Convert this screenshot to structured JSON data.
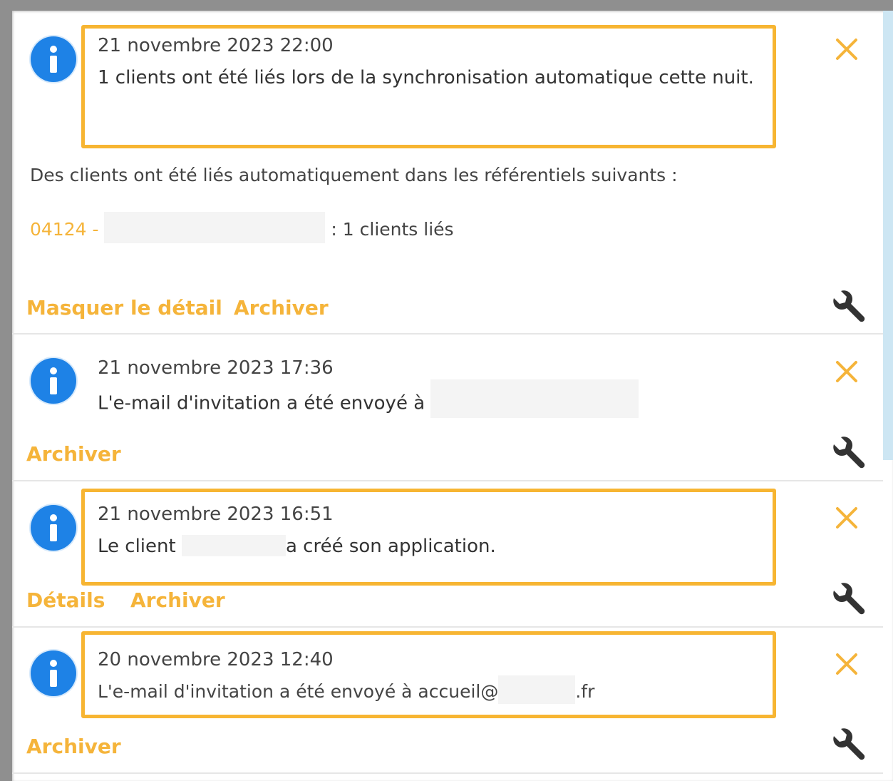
{
  "notifications": [
    {
      "date": "21 novembre 2023 22:00",
      "message": "1 clients ont été liés lors de la synchronisation automatique cette nuit.",
      "detail_intro": "Des clients ont été liés automatiquement dans les référentiels suivants :",
      "detail_code": "04124 -",
      "detail_suffix": ": 1 clients liés",
      "actions": [
        "Masquer le détail",
        "Archiver"
      ]
    },
    {
      "date": "21 novembre 2023 17:36",
      "message": "L'e-mail d'invitation a été envoyé à",
      "actions": [
        "Archiver"
      ]
    },
    {
      "date": "21 novembre 2023 16:51",
      "message_prefix": "Le client",
      "message_suffix": "a créé son application.",
      "actions": [
        "Détails",
        "Archiver"
      ]
    },
    {
      "date": "20 novembre 2023 12:40",
      "message_prefix": "L'e-mail d'invitation a été envoyé à accueil@",
      "message_suffix": ".fr",
      "actions": [
        "Archiver"
      ]
    }
  ],
  "icons": {
    "info": "info-icon",
    "close": "close-icon",
    "settings": "wrench-icon"
  },
  "colors": {
    "accent": "#f5b43a",
    "highlight_border": "#f7b532",
    "info_blue": "#1e82e6"
  }
}
